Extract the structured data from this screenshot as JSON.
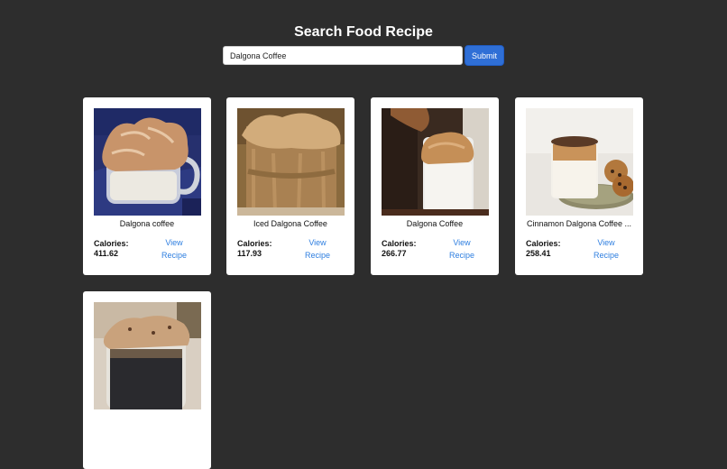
{
  "header": {
    "title": "Search Food Recipe"
  },
  "search": {
    "value": "Dalgona Coffee",
    "submit_label": "Submit"
  },
  "labels": {
    "calories": "Calories:",
    "view_recipe": "View Recipe"
  },
  "recipes": [
    {
      "name": "Dalgona coffee",
      "calories": "411.62"
    },
    {
      "name": "Iced Dalgona Coffee",
      "calories": "117.93"
    },
    {
      "name": "Dalgona Coffee",
      "calories": "266.77"
    },
    {
      "name": "Cinnamon Dalgona Coffee ...",
      "calories": "258.41"
    },
    {
      "name": "",
      "calories": ""
    }
  ],
  "colors": {
    "background": "#2d2d2d",
    "accent": "#2f6fd6",
    "link": "#2f7fe0",
    "card": "#ffffff"
  }
}
